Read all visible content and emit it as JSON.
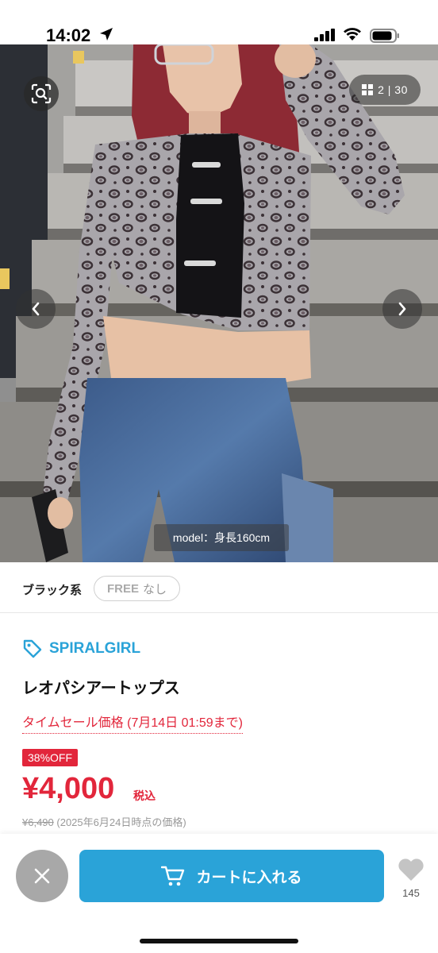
{
  "status_bar": {
    "time": "14:02",
    "icons": [
      "location-arrow-icon",
      "cellular-signal-icon",
      "wifi-icon",
      "battery-icon"
    ]
  },
  "gallery": {
    "counter": "2 | 30",
    "model_caption": "model：身長160cm",
    "icons": [
      "image-search-icon",
      "grid-icon",
      "chevron-left-icon",
      "chevron-right-icon"
    ]
  },
  "variant": {
    "color": "ブラック系",
    "size_name": "FREE",
    "size_stock": "なし"
  },
  "product": {
    "brand": "SPIRALGIRL",
    "title": "レオパシアートップス",
    "sale_label": "タイムセール価格 (7月14日 01:59まで)",
    "discount_badge": "38%OFF",
    "price": "¥4,000",
    "tax_label": "税込",
    "original_price": "¥6,490",
    "original_price_note": "(2025年6月24日時点の価格)"
  },
  "actions": {
    "cart_label": "カートに入れる",
    "favorite_count": "145",
    "icons": [
      "close-icon",
      "cart-icon",
      "heart-icon"
    ]
  },
  "colors": {
    "accent_blue": "#2aa3d8",
    "sale_red": "#e2263b",
    "close_gray": "#a8a8a8"
  }
}
